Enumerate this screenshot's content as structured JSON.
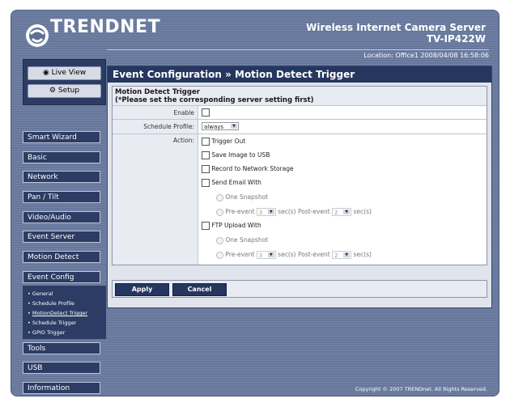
{
  "brand": {
    "logo": "TRENDNET"
  },
  "header": {
    "product_line1": "Wireless Internet Camera Server",
    "product_line2": "TV-IP422W",
    "location": "Location: Office1   2008/04/08 16:58:06"
  },
  "view": {
    "live_view": "Live View",
    "setup": "Setup"
  },
  "nav": {
    "items": [
      "Smart Wizard",
      "Basic",
      "Network",
      "Pan / Tilt",
      "Video/Audio",
      "Event Server",
      "Motion Detect",
      "Event Config",
      "Tools",
      "USB",
      "Information"
    ],
    "submenu": [
      "General",
      "Schedule Profile",
      "MotionDetect Trigger",
      "Schedule Trigger",
      "GPIO Trigger"
    ]
  },
  "main": {
    "title": "Event Configuration » Motion Detect Trigger",
    "section_title": "Motion Detect Trigger",
    "section_note": "(*Please set the corresponding server setting first)",
    "enable_label": "Enable",
    "schedule_label": "Schedule Profile:",
    "schedule_value": "always",
    "action_label": "Action:",
    "trigger_out": "Trigger Out",
    "save_usb": "Save Image to USB",
    "record_storage": "Record to Network Storage",
    "send_email": "Send Email With",
    "ftp_upload": "FTP Upload With",
    "one_snapshot": "One Snapshot",
    "pre_event": "Pre-event",
    "post_event": "Post-event",
    "sec": "sec(s)",
    "pre_value": "3",
    "post_value": "2"
  },
  "buttons": {
    "apply": "Apply",
    "cancel": "Cancel"
  },
  "footer": {
    "copyright": "Copyright © 2007 TRENDnet. All Rights Reserved."
  }
}
